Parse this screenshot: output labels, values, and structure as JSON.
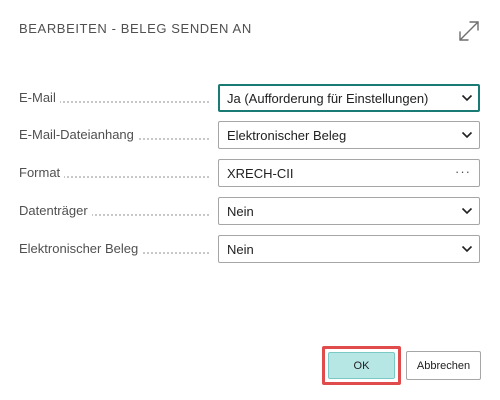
{
  "dialog": {
    "title": "BEARBEITEN - BELEG SENDEN AN",
    "expand_icon": "expand-diagonal-arrows-icon"
  },
  "fields": [
    {
      "label": "E-Mail",
      "value": "Ja (Aufforderung für Einstellungen)",
      "control": "dropdown",
      "focused": true
    },
    {
      "label": "E-Mail-Dateianhang",
      "value": "Elektronischer Beleg",
      "control": "dropdown"
    },
    {
      "label": "Format",
      "value": "XRECH-CII",
      "control": "lookup",
      "lookup_glyph": "···"
    },
    {
      "label": "Datenträger",
      "value": "Nein",
      "control": "dropdown"
    },
    {
      "label": "Elektronischer Beleg",
      "value": "Nein",
      "control": "dropdown"
    }
  ],
  "buttons": {
    "ok_label": "OK",
    "cancel_label": "Abbrechen"
  },
  "colors": {
    "focus_border": "#1a7a74",
    "ok_background": "#b7e7e4",
    "highlight": "#e04b4b"
  }
}
